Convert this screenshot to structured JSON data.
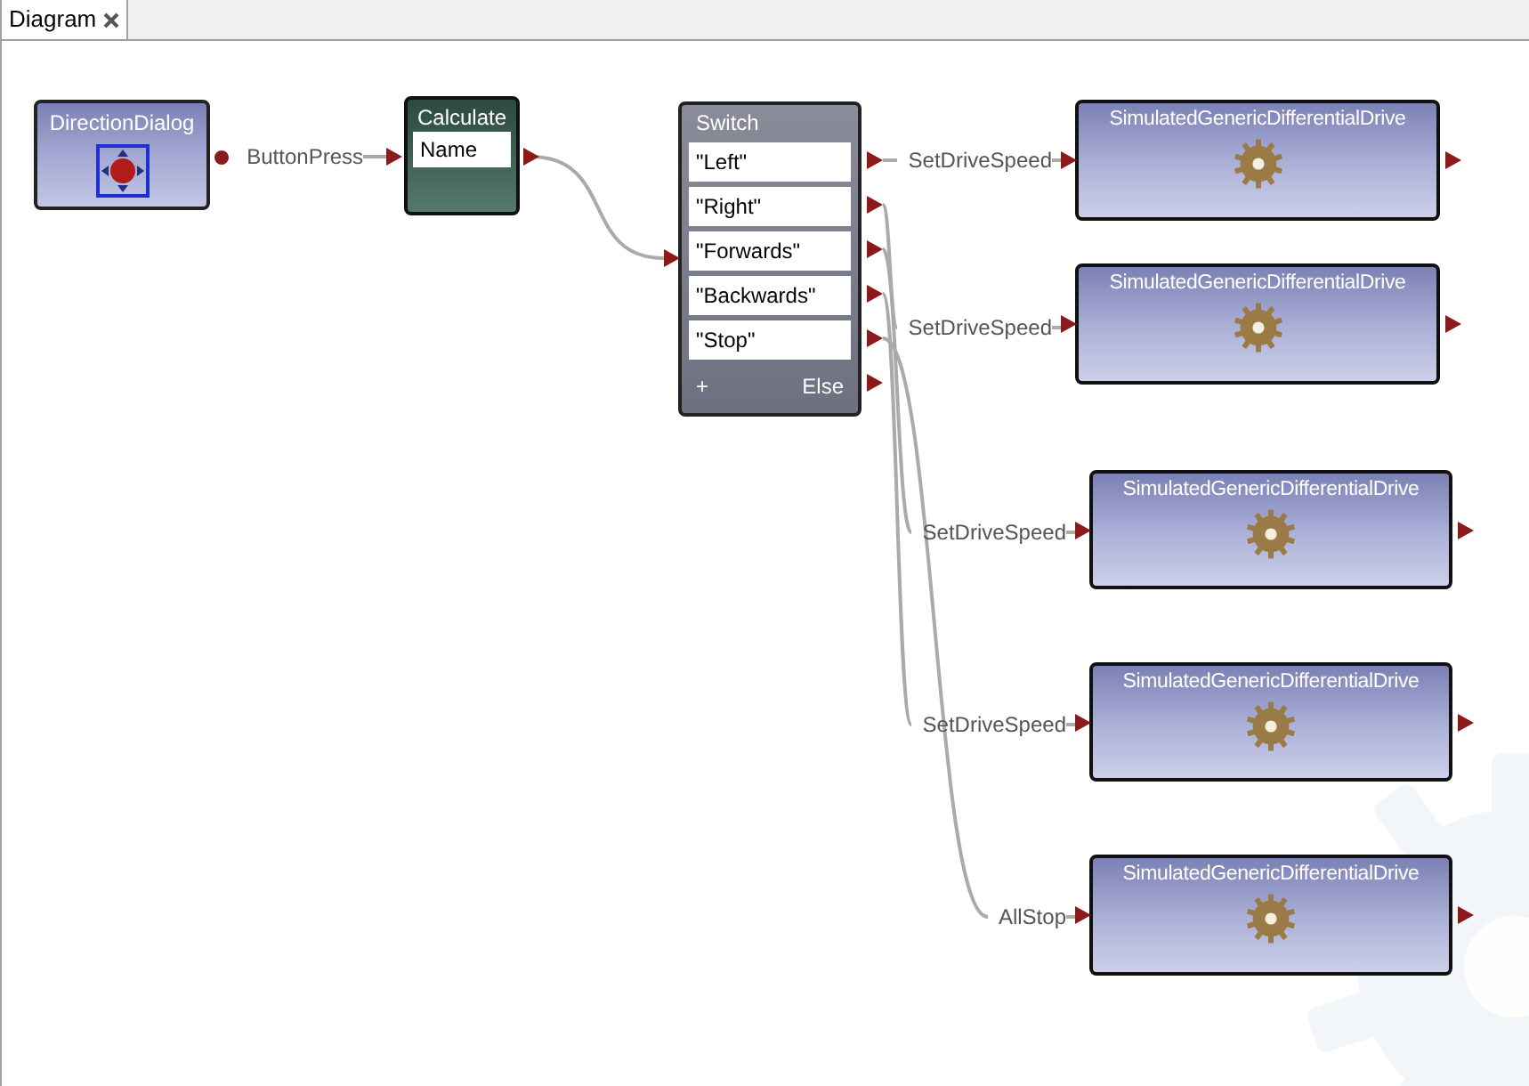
{
  "tab": {
    "label": "Diagram",
    "selected": true
  },
  "nodes": [
    {
      "kind": "dialog",
      "title": "DirectionDialog"
    },
    {
      "kind": "calculate",
      "title": "Calculate",
      "field": "Name"
    },
    {
      "kind": "switch",
      "title": "Switch",
      "cases": [
        "\"Left\"",
        "\"Right\"",
        "\"Forwards\"",
        "\"Backwards\"",
        "\"Stop\""
      ],
      "add": "+",
      "else": "Else"
    },
    {
      "kind": "service",
      "title": "SimulatedGenericDifferentialDrive"
    },
    {
      "kind": "service",
      "title": "SimulatedGenericDifferentialDrive"
    },
    {
      "kind": "service",
      "title": "SimulatedGenericDifferentialDrive"
    },
    {
      "kind": "service",
      "title": "SimulatedGenericDifferentialDrive"
    },
    {
      "kind": "service",
      "title": "SimulatedGenericDifferentialDrive"
    }
  ],
  "messages": [
    "ButtonPress",
    "SetDriveSpeed",
    "SetDriveSpeed",
    "SetDriveSpeed",
    "SetDriveSpeed",
    "AllStop"
  ]
}
